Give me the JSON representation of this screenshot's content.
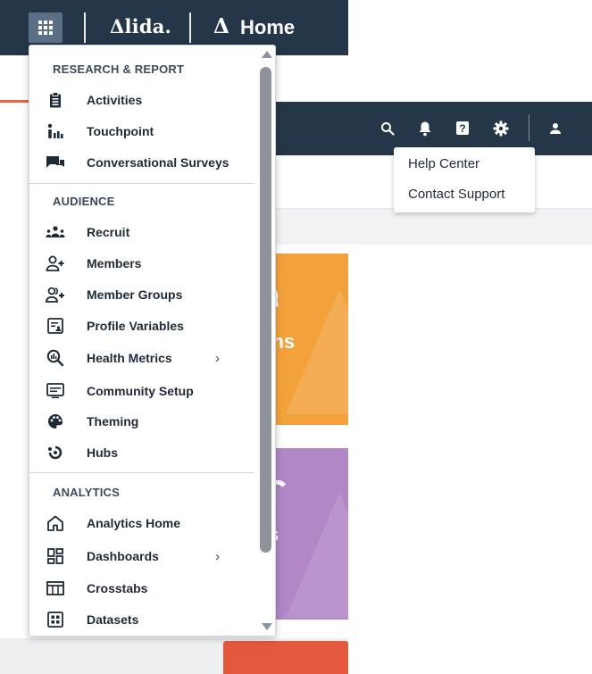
{
  "app": {
    "logo_text": "Δlida.",
    "home_icon_glyph": "Δ",
    "home_title": "Home",
    "icons": [
      "apps-grid-icon",
      "search-icon",
      "bell-icon",
      "help-icon",
      "gear-icon",
      "user-icon"
    ]
  },
  "help_menu": {
    "items": [
      {
        "label": "Help Center"
      },
      {
        "label": "Contact Support"
      }
    ]
  },
  "tiles": {
    "orange_label": "ions",
    "purple_label": "s"
  },
  "menu": {
    "sections": [
      {
        "header": "RESEARCH & REPORT",
        "items": [
          {
            "label": "Activities",
            "icon": "clipboard-icon"
          },
          {
            "label": "Touchpoint",
            "icon": "touchpoint-icon"
          },
          {
            "label": "Conversational Surveys",
            "icon": "chat-icon"
          }
        ]
      },
      {
        "header": "AUDIENCE",
        "items": [
          {
            "label": "Recruit",
            "icon": "recruit-icon"
          },
          {
            "label": "Members",
            "icon": "person-add-icon"
          },
          {
            "label": "Member Groups",
            "icon": "group-add-icon"
          },
          {
            "label": "Profile Variables",
            "icon": "profile-variables-icon"
          },
          {
            "label": "Health Metrics",
            "icon": "health-metrics-icon",
            "has_submenu": true
          },
          {
            "label": "Community Setup",
            "icon": "community-setup-icon"
          },
          {
            "label": "Theming",
            "icon": "palette-icon"
          },
          {
            "label": "Hubs",
            "icon": "hubs-icon"
          }
        ]
      },
      {
        "header": "ANALYTICS",
        "items": [
          {
            "label": "Analytics Home",
            "icon": "home-icon"
          },
          {
            "label": "Dashboards",
            "icon": "dashboard-icon",
            "has_submenu": true
          },
          {
            "label": "Crosstabs",
            "icon": "table-icon"
          },
          {
            "label": "Datasets",
            "icon": "dataset-icon"
          }
        ]
      }
    ],
    "chevron": "›"
  },
  "colors": {
    "header_bg": "#253648",
    "accent_orange": "#f3a23b",
    "accent_purple": "#b187c6",
    "accent_red": "#e4583e"
  }
}
